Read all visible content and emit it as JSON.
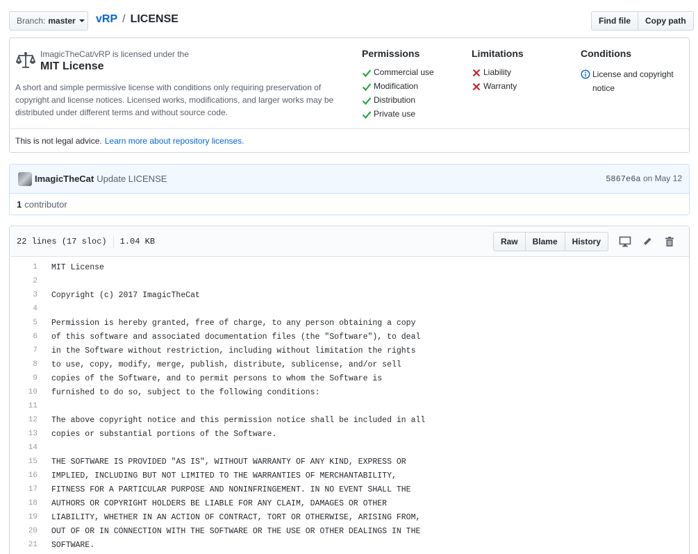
{
  "header": {
    "branch_label": "Branch:",
    "branch_name": "master",
    "repo": "vRP",
    "separator": "/",
    "file": "LICENSE",
    "find_file": "Find file",
    "copy_path": "Copy path"
  },
  "license": {
    "licensed_by": "ImagicTheCat/vRP is licensed under the",
    "name": "MIT License",
    "description": "A short and simple permissive license with conditions only requiring preservation of copyright and license notices. Licensed works, modifications, and larger works may be distributed under different terms and without source code.",
    "permissions": {
      "title": "Permissions",
      "items": [
        "Commercial use",
        "Modification",
        "Distribution",
        "Private use"
      ]
    },
    "limitations": {
      "title": "Limitations",
      "items": [
        "Liability",
        "Warranty"
      ]
    },
    "conditions": {
      "title": "Conditions",
      "items": [
        "License and copyright notice"
      ]
    },
    "footer_text": "This is not legal advice.",
    "footer_link": "Learn more about repository licenses."
  },
  "commit": {
    "author": "ImagicTheCat",
    "message": "Update LICENSE",
    "sha": "5867e6a",
    "date": "on May 12",
    "contributors_count": "1",
    "contributors_label": "contributor"
  },
  "file": {
    "lines_info": "22 lines (17 sloc)",
    "size": "1.04 KB",
    "raw": "Raw",
    "blame": "Blame",
    "history": "History",
    "code": [
      {
        "n": "1",
        "t": "MIT License"
      },
      {
        "n": "2",
        "t": ""
      },
      {
        "n": "3",
        "t": "Copyright (c) 2017 ImagicTheCat"
      },
      {
        "n": "4",
        "t": ""
      },
      {
        "n": "5",
        "t": "Permission is hereby granted, free of charge, to any person obtaining a copy"
      },
      {
        "n": "6",
        "t": "of this software and associated documentation files (the \"Software\"), to deal"
      },
      {
        "n": "7",
        "t": "in the Software without restriction, including without limitation the rights"
      },
      {
        "n": "8",
        "t": "to use, copy, modify, merge, publish, distribute, sublicense, and/or sell"
      },
      {
        "n": "9",
        "t": "copies of the Software, and to permit persons to whom the Software is"
      },
      {
        "n": "10",
        "t": "furnished to do so, subject to the following conditions:"
      },
      {
        "n": "11",
        "t": ""
      },
      {
        "n": "12",
        "t": "The above copyright notice and this permission notice shall be included in all"
      },
      {
        "n": "13",
        "t": "copies or substantial portions of the Software."
      },
      {
        "n": "14",
        "t": ""
      },
      {
        "n": "15",
        "t": "THE SOFTWARE IS PROVIDED \"AS IS\", WITHOUT WARRANTY OF ANY KIND, EXPRESS OR"
      },
      {
        "n": "16",
        "t": "IMPLIED, INCLUDING BUT NOT LIMITED TO THE WARRANTIES OF MERCHANTABILITY,"
      },
      {
        "n": "17",
        "t": "FITNESS FOR A PARTICULAR PURPOSE AND NONINFRINGEMENT. IN NO EVENT SHALL THE"
      },
      {
        "n": "18",
        "t": "AUTHORS OR COPYRIGHT HOLDERS BE LIABLE FOR ANY CLAIM, DAMAGES OR OTHER"
      },
      {
        "n": "19",
        "t": "LIABILITY, WHETHER IN AN ACTION OF CONTRACT, TORT OR OTHERWISE, ARISING FROM,"
      },
      {
        "n": "20",
        "t": "OUT OF OR IN CONNECTION WITH THE SOFTWARE OR THE USE OR OTHER DEALINGS IN THE"
      },
      {
        "n": "21",
        "t": "SOFTWARE."
      }
    ]
  },
  "icons": {
    "license": "scale-icon",
    "permission": "check-icon",
    "limitation": "x-icon",
    "condition": "info-icon",
    "display": "desktop-icon",
    "edit": "pencil-icon",
    "delete": "trash-icon"
  },
  "colors": {
    "link": "#0366d6",
    "check": "#28a745",
    "cross": "#cb2431",
    "info": "#0366d6",
    "commit_bg": "#f1f8ff"
  }
}
